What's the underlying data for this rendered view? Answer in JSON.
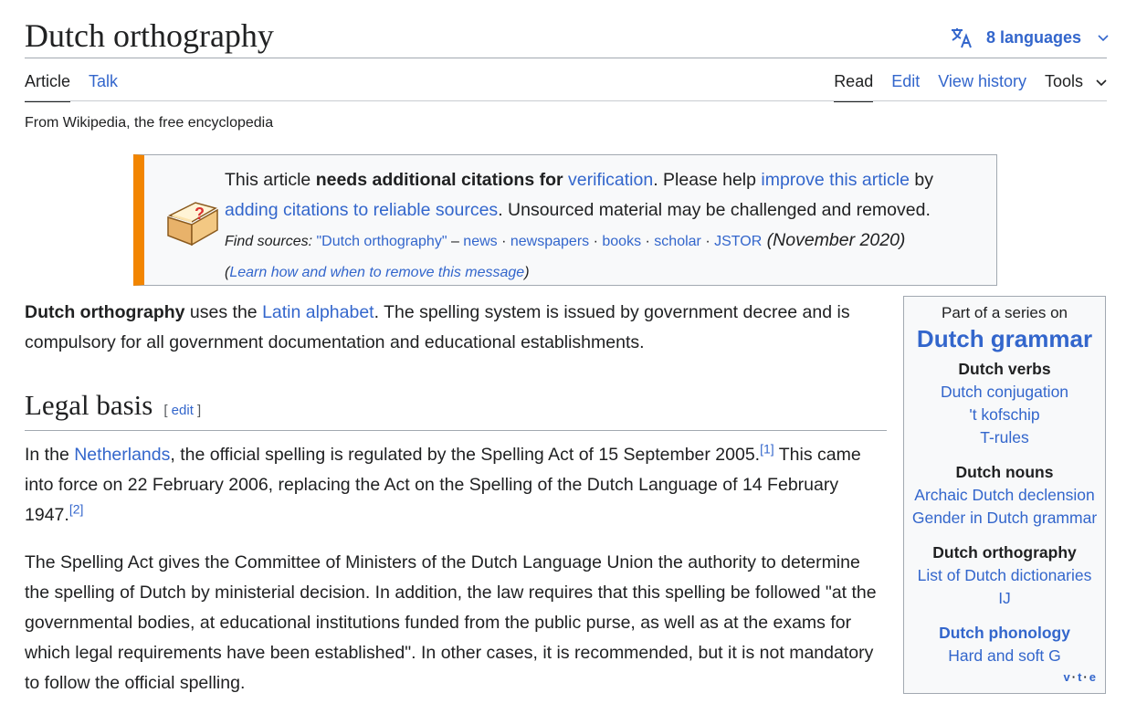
{
  "page": {
    "title": "Dutch orthography",
    "languages_label": "8 languages",
    "tagline": "From Wikipedia, the free encyclopedia"
  },
  "tabs": {
    "article": "Article",
    "talk": "Talk",
    "read": "Read",
    "edit": "Edit",
    "view_history": "View history",
    "tools": "Tools"
  },
  "notice": {
    "t1": "This article ",
    "bold": "needs additional citations for ",
    "verification": "verification",
    "t2": ". Please help ",
    "improve": "improve this article",
    "t3": " by ",
    "adding": "adding citations to reliable sources",
    "t4": ". Unsourced material may be challenged and removed.",
    "find_sources": "Find sources:",
    "query": "\"Dutch orthography\"",
    "dash": " – ",
    "news": "news",
    "newspapers": "newspapers",
    "books": "books",
    "scholar": "scholar",
    "jstor": "JSTOR",
    "sep": " · ",
    "date": "(November 2020)",
    "open_paren": "(",
    "learn": "Learn how and when to remove this message",
    "close_paren": ")"
  },
  "intro": {
    "bold": "Dutch orthography",
    "t1": " uses the ",
    "latin": "Latin alphabet",
    "t2": ". The spelling system is issued by government decree and is compulsory for all government documentation and educational establishments."
  },
  "section": {
    "heading": "Legal basis",
    "edit_open": "[ ",
    "edit": "edit",
    "edit_close": " ]"
  },
  "para2": {
    "t1": "In the ",
    "netherlands": "Netherlands",
    "t2": ", the official spelling is regulated by the Spelling Act of 15 September 2005.",
    "ref1": "[1]",
    "t3": " This came into force on 22 February 2006, replacing the Act on the Spelling of the Dutch Language of 14 February 1947.",
    "ref2": "[2]"
  },
  "para3": {
    "text": "The Spelling Act gives the Committee of Ministers of the Dutch Language Union the authority to determine the spelling of Dutch by ministerial decision. In addition, the law requires that this spelling be followed \"at the governmental bodies, at educational institutions funded from the public purse, as well as at the exams for which legal requirements have been established\". In other cases, it is recommended, but it is not mandatory to follow the official spelling."
  },
  "sidebar": {
    "part_of": "Part of a series on",
    "title": "Dutch grammar",
    "verbs_heading": "Dutch verbs",
    "verbs": [
      "Dutch conjugation",
      "'t kofschip",
      "T-rules"
    ],
    "nouns_heading": "Dutch nouns",
    "nouns": [
      "Archaic Dutch declension",
      "Gender in Dutch grammar"
    ],
    "ortho_heading": "Dutch orthography",
    "ortho": [
      "List of Dutch dictionaries",
      "IJ"
    ],
    "phon_heading": "Dutch phonology",
    "phon": [
      "Hard and soft G"
    ],
    "vte_v": "v",
    "vte_t": "t",
    "vte_e": "e",
    "vte_dot": "·"
  },
  "colors": {
    "link": "#3366cc",
    "notice_bar": "#f28500",
    "text": "#202122"
  }
}
